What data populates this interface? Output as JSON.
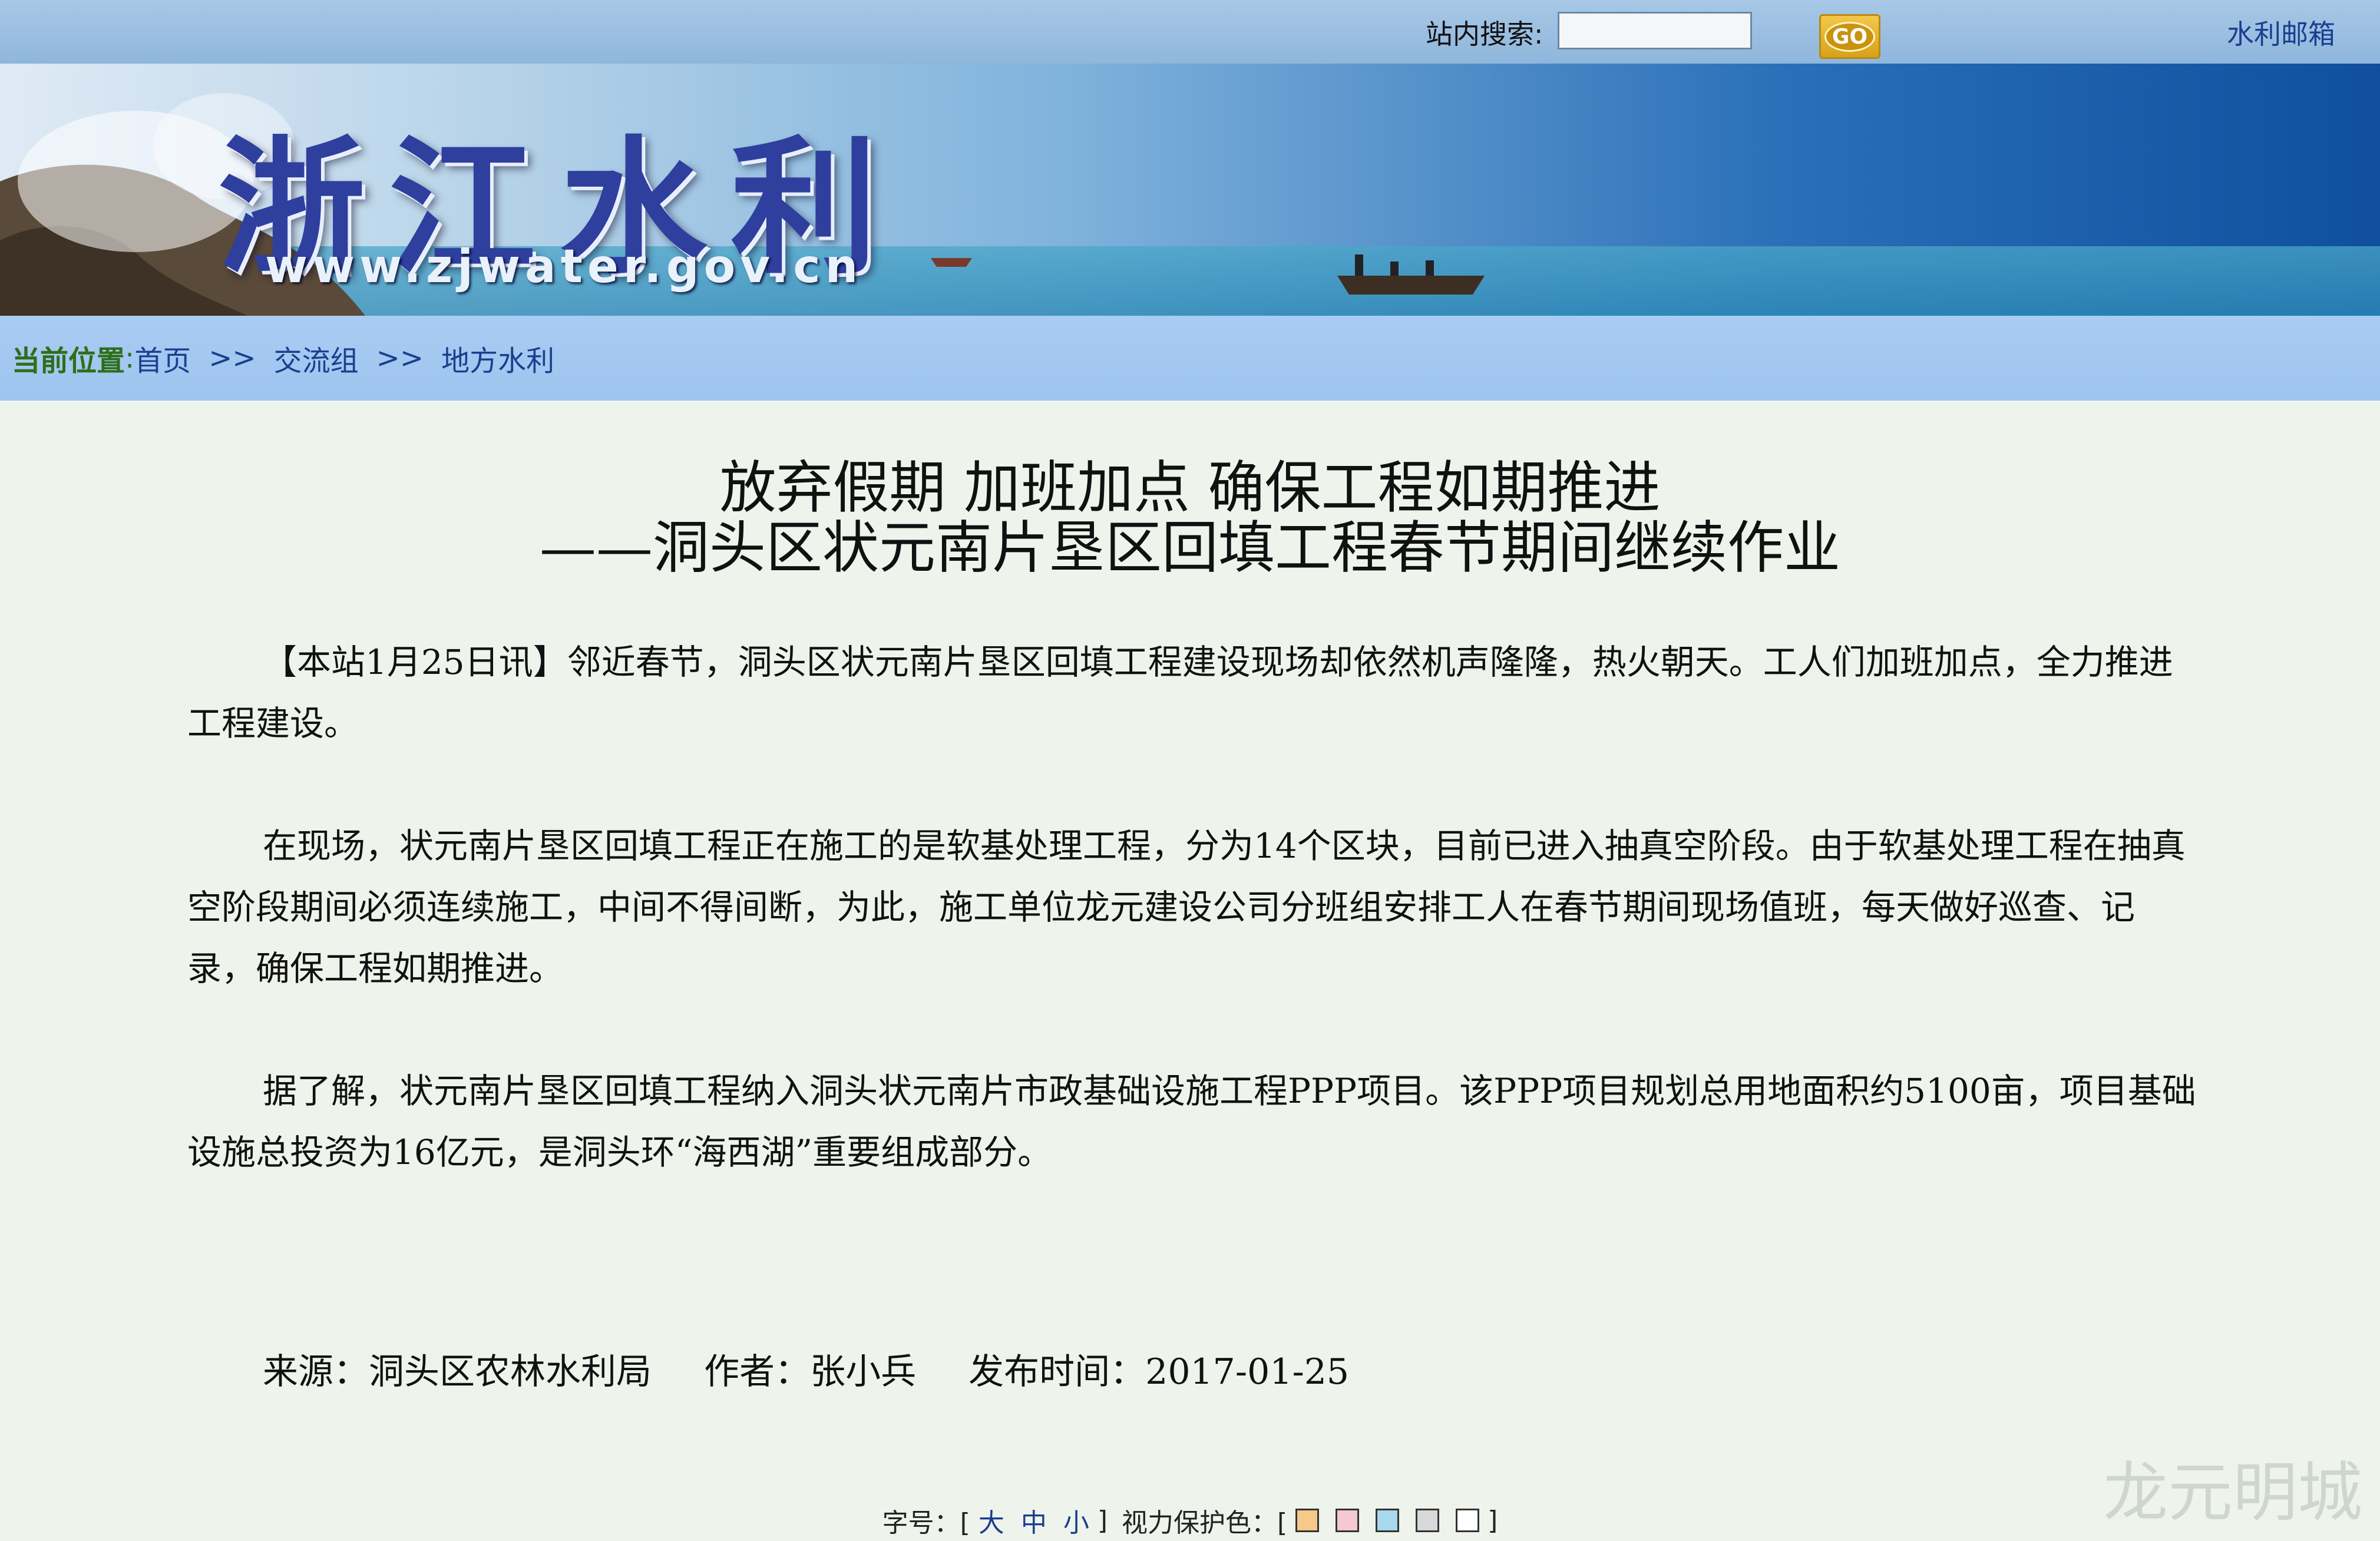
{
  "topbar": {
    "search_label": "站内搜索:",
    "search_value": "",
    "go_label": "GO",
    "mail_label": "水利邮箱"
  },
  "banner": {
    "title": "浙江水利",
    "url": "www.zjwater.gov.cn"
  },
  "breadcrumb": {
    "label": "当前位置",
    "colon": ":",
    "items": [
      "首页",
      "交流组",
      "地方水利"
    ],
    "separator": ">>"
  },
  "article": {
    "title_line1": "放弃假期 加班加点 确保工程如期推进",
    "title_line2": "——洞头区状元南片垦区回填工程春节期间继续作业",
    "paragraphs": [
      "【本站1月25日讯】邻近春节，洞头区状元南片垦区回填工程建设现场却依然机声隆隆，热火朝天。工人们加班加点，全力推进工程建设。",
      "在现场，状元南片垦区回填工程正在施工的是软基处理工程，分为14个区块，目前已进入抽真空阶段。由于软基处理工程在抽真空阶段期间必须连续施工，中间不得间断，为此，施工单位龙元建设公司分班组安排工人在春节期间现场值班，每天做好巡查、记录，确保工程如期推进。",
      "据了解，状元南片垦区回填工程纳入洞头状元南片市政基础设施工程PPP项目。该PPP项目规划总用地面积约5100亩，项目基础设施总投资为16亿元，是洞头环“海西湖”重要组成部分。"
    ],
    "source": "来源：洞头区农林水利局",
    "author": "作者：张小兵",
    "date": "发布时间：2017-01-25"
  },
  "font_controls": {
    "size_label": "字号：[",
    "large": "大",
    "medium": "中",
    "small": "小",
    "close_bracket": "]",
    "color_label": "视力保护色：[",
    "swatches": [
      "#f5c98a",
      "#f4c8d4",
      "#a8d8ec",
      "#d8d8d8",
      "#ffffff"
    ]
  },
  "watermark": "龙元明城"
}
